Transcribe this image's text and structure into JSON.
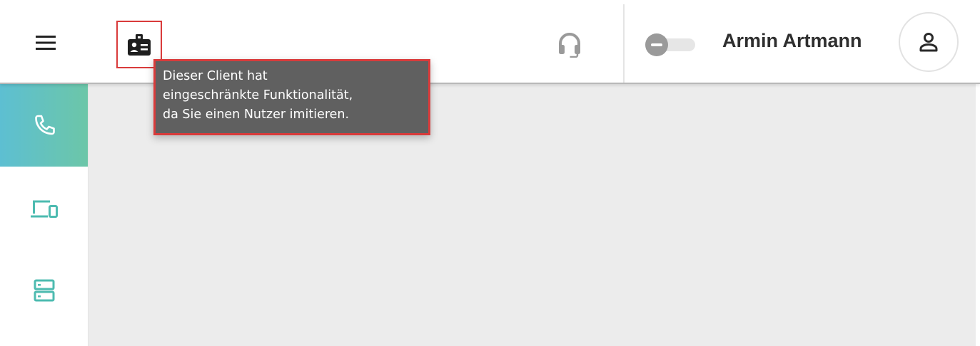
{
  "header": {
    "menu_icon": "hamburger-menu-icon",
    "impersonation_icon": "id-badge-icon",
    "headset_icon": "headset-icon",
    "status_toggle_state": "off",
    "user_name": "Armin Artmann",
    "avatar_icon": "person-icon"
  },
  "tooltip": {
    "lines": [
      "Dieser Client hat",
      "eingeschränkte Funktionalität,",
      "da Sie einen Nutzer imitieren."
    ]
  },
  "sidebar": {
    "items": [
      {
        "icon": "phone-icon",
        "active": true
      },
      {
        "icon": "devices-icon",
        "active": false
      },
      {
        "icon": "server-icon",
        "active": false
      }
    ]
  },
  "colors": {
    "accent_gradient_start": "#5dbfd2",
    "accent_gradient_end": "#6cc6a8",
    "highlight_border": "#d93b3b",
    "tooltip_bg": "#606060",
    "content_bg": "#ececec"
  }
}
